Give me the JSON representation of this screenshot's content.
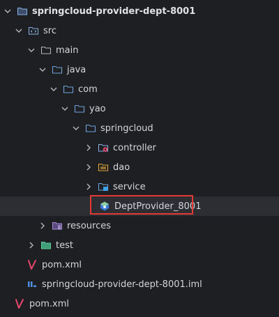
{
  "tree": {
    "items": [
      {
        "label": "springcloud-provider-dept-8001",
        "icon": "folder-icon"
      },
      {
        "label": "src",
        "icon": "source-folder-icon"
      },
      {
        "label": "main",
        "icon": "folder-icon"
      },
      {
        "label": "java",
        "icon": "folder-icon"
      },
      {
        "label": "com",
        "icon": "package-icon"
      },
      {
        "label": "yao",
        "icon": "package-icon"
      },
      {
        "label": "springcloud",
        "icon": "package-icon"
      },
      {
        "label": "controller",
        "icon": "controller-folder-icon"
      },
      {
        "label": "dao",
        "icon": "dao-folder-icon"
      },
      {
        "label": "service",
        "icon": "service-folder-icon"
      },
      {
        "label": "DeptProvider_8001",
        "icon": "spring-boot-class-icon"
      },
      {
        "label": "resources",
        "icon": "resources-folder-icon"
      },
      {
        "label": "test",
        "icon": "test-folder-icon"
      },
      {
        "label": "pom.xml",
        "icon": "maven-icon"
      },
      {
        "label": "springcloud-provider-dept-8001.iml",
        "icon": "iml-file-icon"
      },
      {
        "label": "pom.xml",
        "icon": "maven-icon"
      }
    ]
  },
  "colors": {
    "background": "#1e1f22",
    "text": "#d4d6da",
    "folder": "#6f9fd8",
    "highlight_border": "#e53935",
    "maven": "#e5476b"
  }
}
